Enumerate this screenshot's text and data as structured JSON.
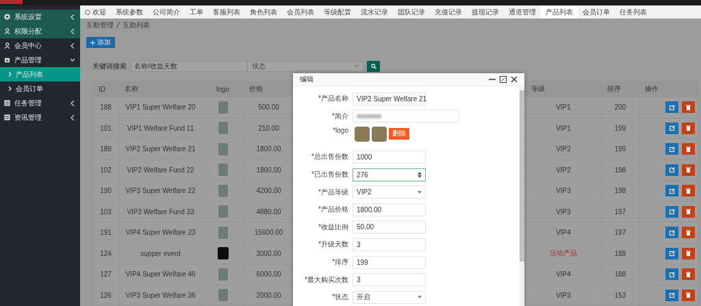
{
  "sidebar": {
    "items": [
      {
        "label": "系统设置",
        "expanded": false
      },
      {
        "label": "权限分配",
        "expanded": false
      },
      {
        "label": "会员中心",
        "expanded": false
      },
      {
        "label": "产品管理",
        "expanded": true,
        "children": [
          {
            "label": "产品列表",
            "selected": true
          },
          {
            "label": "会员订单",
            "selected": false
          }
        ]
      },
      {
        "label": "任务管理",
        "expanded": false
      },
      {
        "label": "资讯管理",
        "expanded": false
      }
    ]
  },
  "tabs": [
    {
      "label": "欢迎",
      "selected": false,
      "home": true
    },
    {
      "label": "系统参数",
      "selected": false
    },
    {
      "label": "公司简介",
      "selected": false
    },
    {
      "label": "工单",
      "selected": false
    },
    {
      "label": "客服列表",
      "selected": false
    },
    {
      "label": "角色列表",
      "selected": false
    },
    {
      "label": "会员列表",
      "selected": false
    },
    {
      "label": "等级配置",
      "selected": false
    },
    {
      "label": "流水记录",
      "selected": false
    },
    {
      "label": "团队记录",
      "selected": false
    },
    {
      "label": "充值记录",
      "selected": false
    },
    {
      "label": "提现记录",
      "selected": false
    },
    {
      "label": "通道管理",
      "selected": false
    },
    {
      "label": "产品列表",
      "selected": true
    },
    {
      "label": "会员订单",
      "selected": false
    },
    {
      "label": "任务列表",
      "selected": false
    }
  ],
  "breadcrumb": [
    "互助管理",
    "互助列表"
  ],
  "add_button": "添加",
  "search": {
    "label": "关键词搜索",
    "placeholder": "名称/收益天数",
    "status_placeholder": "状态"
  },
  "table": {
    "columns": [
      "ID",
      "名称",
      "logo",
      "价格",
      "等级",
      "排序",
      "操作"
    ],
    "rows": [
      {
        "id": "188",
        "name": "VIP1 Super Welfare 20",
        "price": "500.00",
        "level": "VIP1",
        "sort": "200",
        "highlight": false
      },
      {
        "id": "101",
        "name": "VIP1 Welfare Fund 11",
        "price": "210.00",
        "level": "VIP1",
        "sort": "199",
        "highlight": false
      },
      {
        "id": "189",
        "name": "VIP2 Super Welfare 21",
        "price": "1800.00",
        "level": "VIP2",
        "sort": "199",
        "highlight": false
      },
      {
        "id": "102",
        "name": "VIP2 Welfare Fund 22",
        "price": "1800.00",
        "level": "VIP2",
        "sort": "198",
        "highlight": false
      },
      {
        "id": "190",
        "name": "VIP3 Super Welfare 22",
        "price": "4200.00",
        "level": "VIP3",
        "sort": "198",
        "highlight": false
      },
      {
        "id": "103",
        "name": "VIP3 Welfare Fund 33",
        "price": "4880.00",
        "level": "VIP3",
        "sort": "197",
        "highlight": false
      },
      {
        "id": "191",
        "name": "VIP4 Super Welfare 23",
        "price": "15600.00",
        "level": "VIP4",
        "sort": "197",
        "highlight": false
      },
      {
        "id": "124",
        "name": "supper everd",
        "price": "3000.00",
        "level": "活动产品",
        "sort": "188",
        "highlight": true
      },
      {
        "id": "127",
        "name": "VIP4 Super Welfare 46",
        "price": "6000.00",
        "level": "VIP4",
        "sort": "188",
        "highlight": false
      },
      {
        "id": "126",
        "name": "VIP3 Super Welfare 36",
        "price": "2000.00",
        "level": "VIP3",
        "sort": "153",
        "highlight": false
      }
    ]
  },
  "modal": {
    "title": "编辑",
    "delete_button": "删除",
    "fields": [
      {
        "label": "*产品名称",
        "kind": "text",
        "value": "VIP2 Super Welfare 21"
      },
      {
        "label": "*简介",
        "kind": "blurred"
      },
      {
        "label": "*logo",
        "kind": "image"
      },
      {
        "label": "*总出售份数",
        "kind": "text",
        "value": "1000"
      },
      {
        "label": "*已出售份数",
        "kind": "number",
        "value": "276",
        "focused": true
      },
      {
        "label": "*产品等级",
        "kind": "select",
        "value": "VIP2"
      },
      {
        "label": "*产品价格",
        "kind": "text",
        "value": "1800.00"
      },
      {
        "label": "*收益比例",
        "kind": "text",
        "value": "50.00"
      },
      {
        "label": "*升级天数",
        "kind": "text",
        "value": "3"
      },
      {
        "label": "*排序",
        "kind": "text",
        "value": "199"
      },
      {
        "label": "*最大购买次数",
        "kind": "text",
        "value": "3"
      },
      {
        "label": "*状态",
        "kind": "select",
        "value": "开启"
      }
    ]
  }
}
